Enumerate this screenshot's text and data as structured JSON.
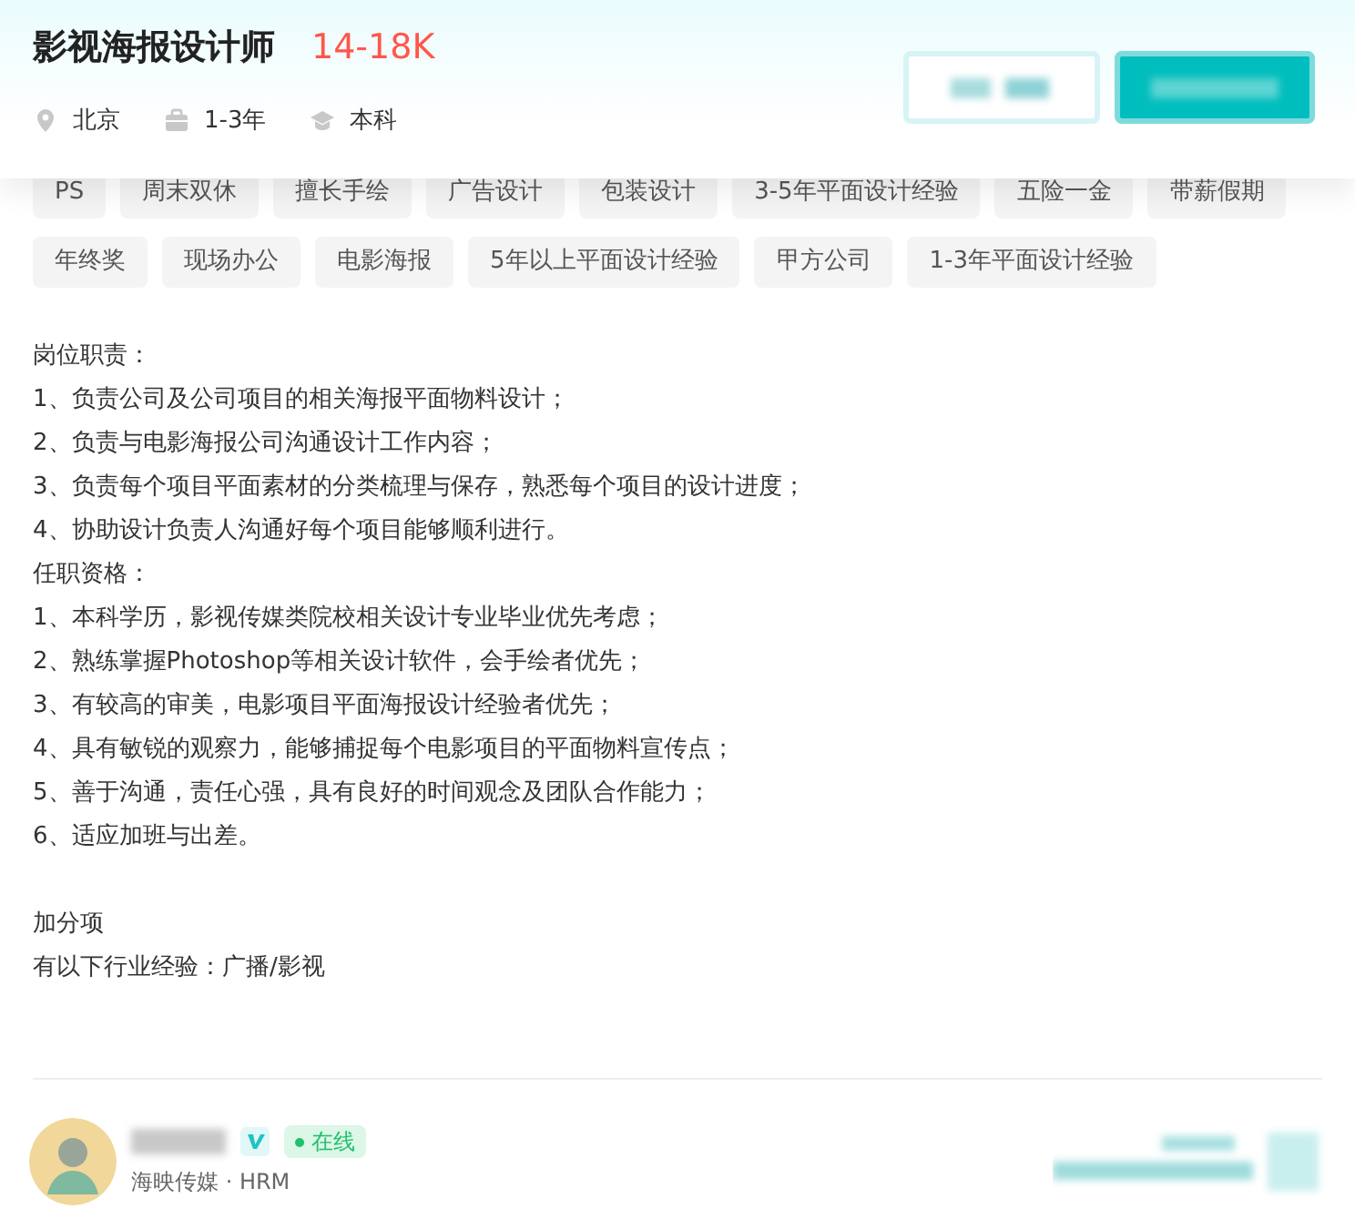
{
  "title": "影视海报设计师",
  "salary": "14-18K",
  "meta": [
    {
      "kind": "location",
      "text": "北京"
    },
    {
      "kind": "experience",
      "text": "1-3年"
    },
    {
      "kind": "degree",
      "text": "本科"
    }
  ],
  "actions": [
    {
      "kind": "outline"
    },
    {
      "kind": "primary"
    }
  ],
  "tags": [
    "PS",
    "周末双休",
    "擅长手绘",
    "广告设计",
    "包装设计",
    "3-5年平面设计经验",
    "五险一金",
    "带薪假期",
    "年终奖",
    "现场办公",
    "电影海报",
    "5年以上平面设计经验",
    "甲方公司",
    "1-3年平面设计经验"
  ],
  "description": [
    [
      "岗位职责：",
      "1、负责公司及公司项目的相关海报平面物料设计；",
      "2、负责与电影海报公司沟通设计工作内容；",
      "3、负责每个项目平面素材的分类梳理与保存，熟悉每个项目的设计进度；",
      "4、协助设计负责人沟通好每个项目能够顺利进行。",
      "任职资格：",
      "1、本科学历，影视传媒类院校相关设计专业毕业优先考虑；",
      "2、熟练掌握Photoshop等相关设计软件，会手绘者优先；",
      "3、有较高的审美，电影项目平面海报设计经验者优先；",
      "4、具有敏锐的观察力，能够捕捉每个电影项目的平面物料宣传点；",
      "5、善于沟通，责任心强，具有良好的时间观念及团队合作能力；",
      "6、适应加班与出差。"
    ],
    [
      "加分项",
      "有以下行业经验：广播/影视"
    ]
  ],
  "recruiter": {
    "verified": true,
    "online": true,
    "status": "在线",
    "subtitle": "海映传媒 · HRM"
  }
}
